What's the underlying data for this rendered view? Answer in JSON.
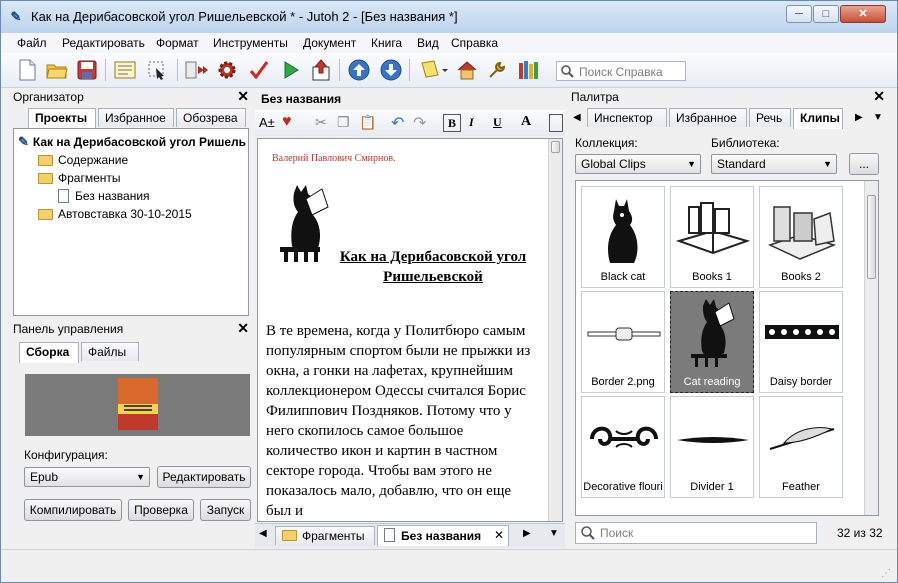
{
  "window": {
    "title": "Как на Дерибасовской угол Ришельевской * - Jutoh 2 - [Без названия *]",
    "app_icon": "jutoh-icon",
    "min": "─",
    "max": "□",
    "close": "✕"
  },
  "menu": [
    "Файл",
    "Редактировать",
    "Формат",
    "Инструменты",
    "Документ",
    "Книга",
    "Вид",
    "Справка"
  ],
  "help_search": {
    "placeholder": "Поиск Справка"
  },
  "organizer": {
    "title": "Организатор",
    "close": "✕",
    "tabs": [
      "Проекты",
      "Избранное",
      "Обозрева"
    ],
    "tree": {
      "root": "Как на Дерибасовской угол Ришель",
      "items": [
        "Содержание",
        "Фрагменты",
        "Без названия",
        "Автовставка 30-10-2015"
      ]
    }
  },
  "control_panel": {
    "title": "Панель управления",
    "close": "✕",
    "tabs": [
      "Сборка",
      "Файлы"
    ],
    "config_label": "Конфигурация:",
    "config_value": "Epub",
    "edit_button": "Редактировать",
    "compile_button": "Компилировать",
    "check_button": "Проверка",
    "run_button": "Запуск"
  },
  "editor": {
    "title": "Без названия",
    "author": "Валерий Павлович Смирнов.",
    "heading": "Как на Дерибасовской угол Ришельевской",
    "paragraph": "В те времена, когда у Политбюро самым популярным спортом были не прыжки из окна, а гонки на лафетах, крупнейшим коллекционером Одессы считался Борис Филиппович Поздняков. Потому что у него скопилось самое большое количество икон и картин в частном секторе города. Чтобы вам этого не показалось мало, добавлю, что он еще был и",
    "bottom_tabs": [
      "Фрагменты",
      "Без названия"
    ],
    "bottom_tab_close": "✕"
  },
  "palette": {
    "title": "Палитра",
    "close": "✕",
    "tabs": [
      "Инспектор",
      "Избранное",
      "Речь",
      "Клипы"
    ],
    "collection_label": "Коллекция:",
    "collection_value": "Global Clips",
    "library_label": "Библиотека:",
    "library_value": "Standard",
    "more_button": "...",
    "clips": [
      "Black cat",
      "Books 1",
      "Books 2",
      "Border 2.png",
      "Cat reading",
      "Daisy border",
      "Decorative flouri",
      "Divider 1",
      "Feather"
    ],
    "selected_clip": "Cat reading",
    "search_placeholder": "Поиск",
    "count": "32 из 32"
  },
  "colors": {
    "accent": "#3874c5",
    "author_red": "#c0392b",
    "selected_clip_bg": "#7b7b7b"
  }
}
